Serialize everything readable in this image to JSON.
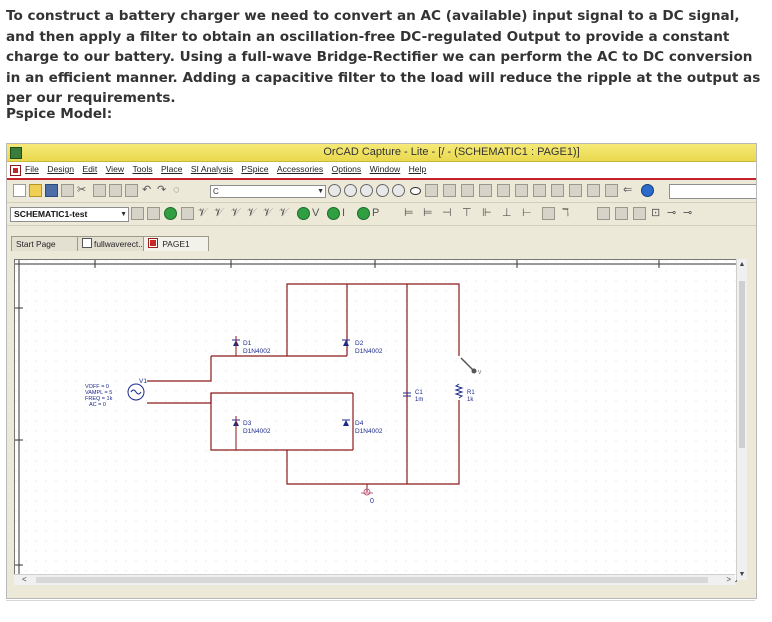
{
  "article": {
    "paragraph": "To construct a battery charger we need to convert an AC (available) input signal to a DC signal, and then apply a filter to obtain an oscillation-free DC-regulated Output to provide a constant charge to our battery. Using a full-wave Bridge-Rectifier we can perform the AC to DC conversion in an efficient manner. Adding a capacitive filter to the load will reduce the ripple at the output as per our requirements.",
    "subheading": "Pspice Model:"
  },
  "window": {
    "title": "OrCAD Capture - Lite - [/ - (SCHEMATIC1 : PAGE1)]"
  },
  "menu": {
    "items": [
      "File",
      "Design",
      "Edit",
      "View",
      "Tools",
      "Place",
      "SI Analysis",
      "PSpice",
      "Accessories",
      "Options",
      "Window",
      "Help"
    ]
  },
  "toolbar": {
    "combo_value": "C",
    "part_combo": "SCHEMATIC1-test"
  },
  "tabs": [
    {
      "label": "Start Page"
    },
    {
      "label": "fullwaverect..."
    },
    {
      "label": "PAGE1"
    }
  ],
  "schematic": {
    "source": {
      "ref": "V1",
      "params": [
        "VOFF = 0",
        "VAMPL = 5",
        "FREQ = 1k",
        "AC = 0"
      ]
    },
    "diodes": [
      {
        "ref": "D1",
        "part": "D1N4002"
      },
      {
        "ref": "D2",
        "part": "D1N4002"
      },
      {
        "ref": "D3",
        "part": "D1N4002"
      },
      {
        "ref": "D4",
        "part": "D1N4002"
      }
    ],
    "capacitor": {
      "ref": "C1",
      "value": "1m"
    },
    "resistor": {
      "ref": "R1",
      "value": "1k"
    },
    "ground_label": "0",
    "probe_label": "V"
  },
  "colors": {
    "wire": "#8b1a1a",
    "part": "#1d2a8a",
    "menu_accent": "#c8202a",
    "titlebar": "#efe063"
  }
}
